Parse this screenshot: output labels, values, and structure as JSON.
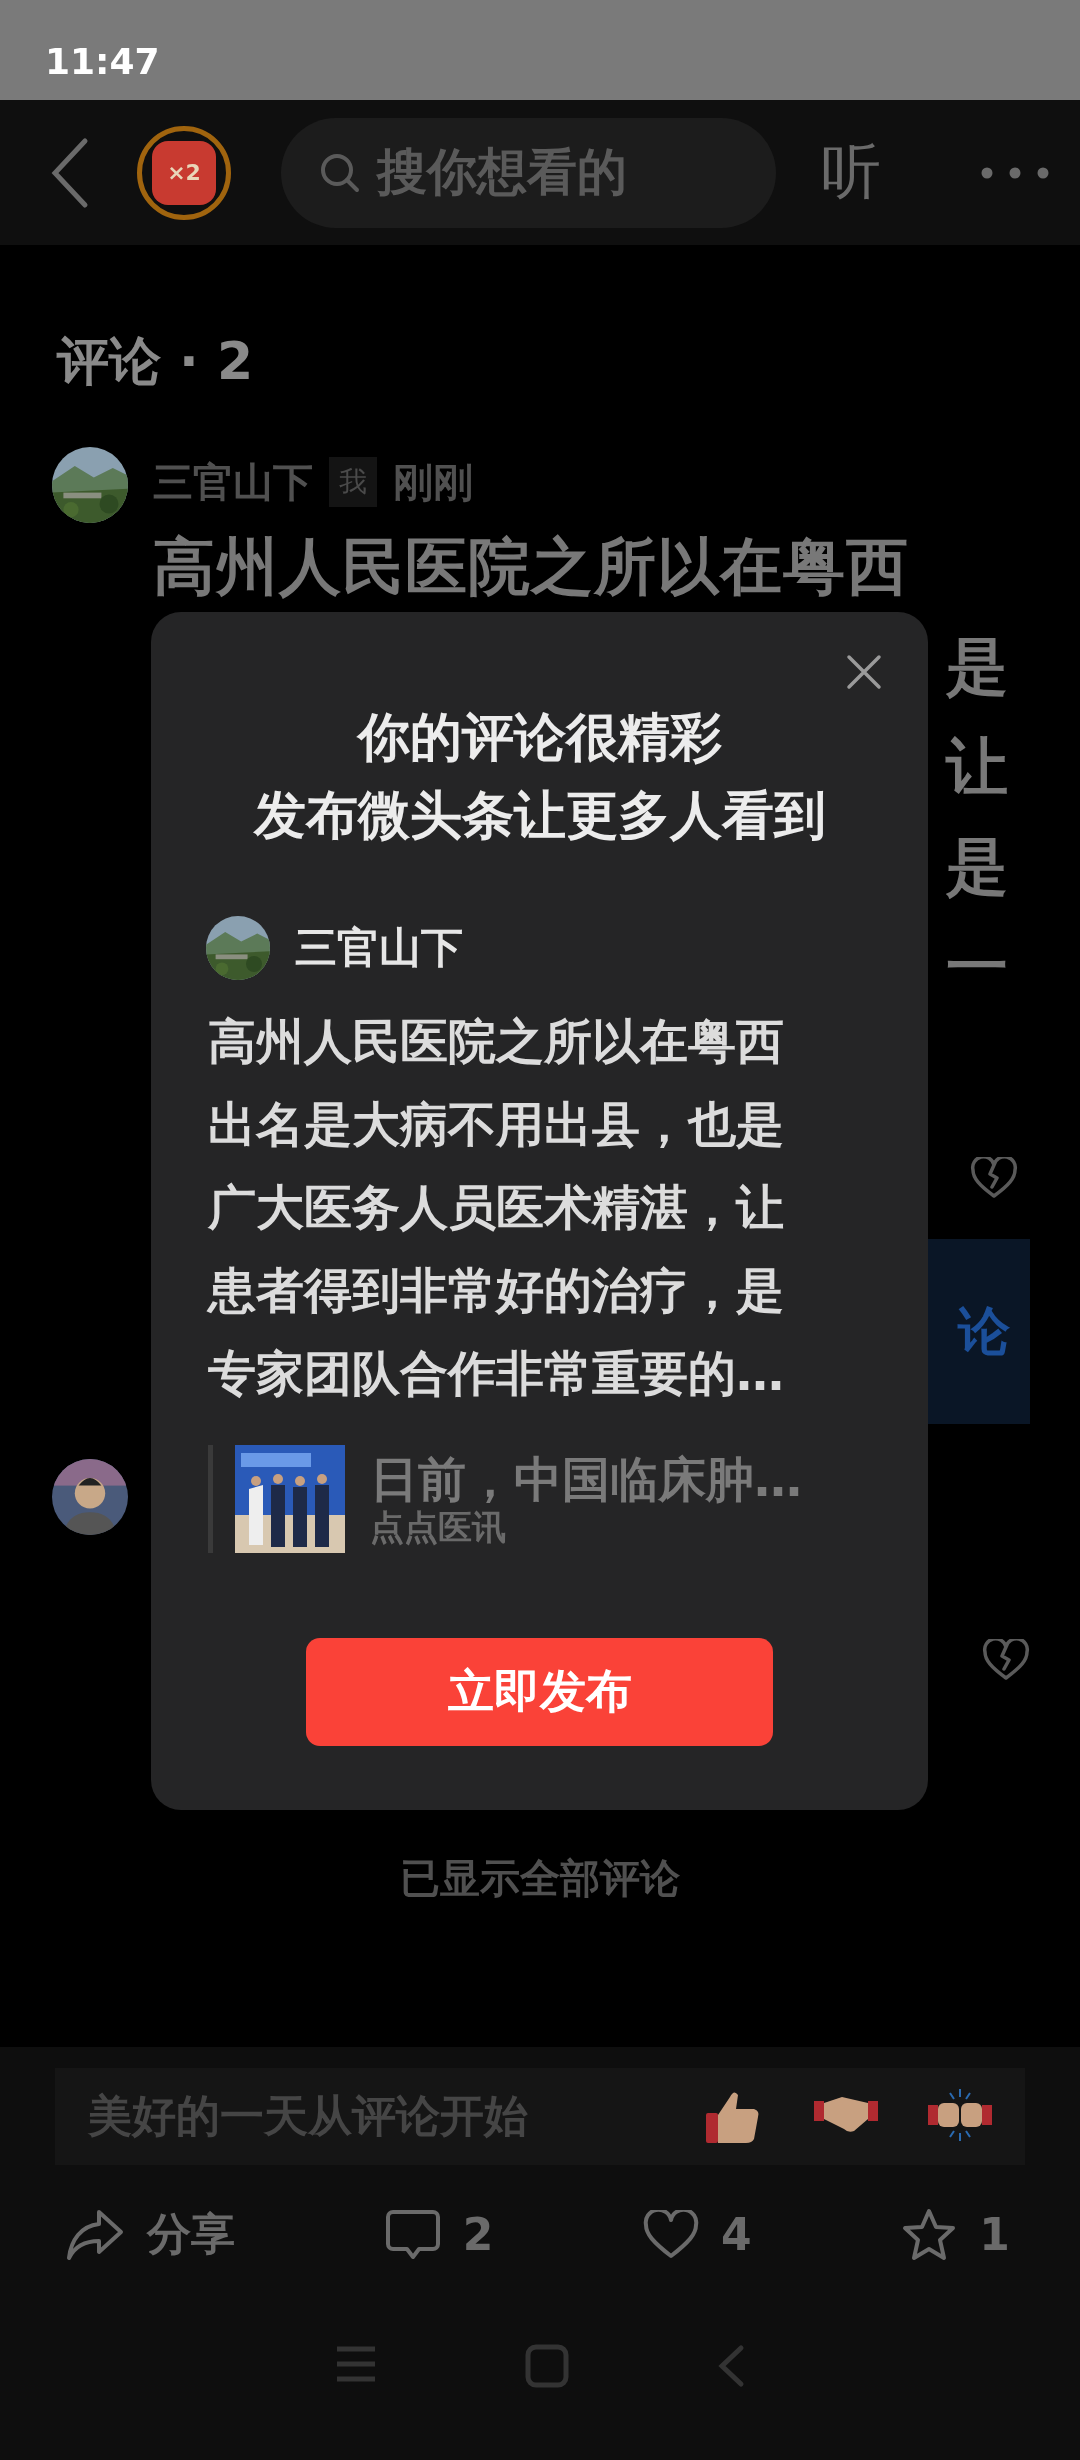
{
  "status_bar": {
    "time": "11:47"
  },
  "top_bar": {
    "badge": "×2",
    "search": {
      "placeholder": "搜你想看的"
    },
    "listen": "听"
  },
  "comments_header": "评论 · 2",
  "comments": [
    {
      "kind": "partial",
      "author": "三官山下",
      "tag": "我",
      "time": "刚刚",
      "first_line": "高州人民医院之所以在粤西",
      "fragments": [
        "是",
        "让",
        "是",
        "一"
      ],
      "topic_fragment": "论"
    },
    {
      "kind": "hidden"
    }
  ],
  "end_note": "已显示全部评论",
  "modal": {
    "title_lines": [
      "你的评论很精彩",
      "发布微头条让更多人看到"
    ],
    "author": "三官山下",
    "text": "高州人民医院之所以在粤西出名是大病不用出县，也是广大医务人员医术精湛，让患者得到非常好的治疗，是专家团队合作非常重要的…",
    "link": {
      "title": "日前，中国临床肿…",
      "source": "点点医讯"
    },
    "button": "立即发布"
  },
  "comment_input": {
    "placeholder": "美好的一天从评论开始"
  },
  "actions": [
    {
      "kind": "share",
      "label": "分享"
    },
    {
      "kind": "comment",
      "label": "2"
    },
    {
      "kind": "like",
      "label": "4"
    },
    {
      "kind": "favorite",
      "label": "1"
    }
  ]
}
